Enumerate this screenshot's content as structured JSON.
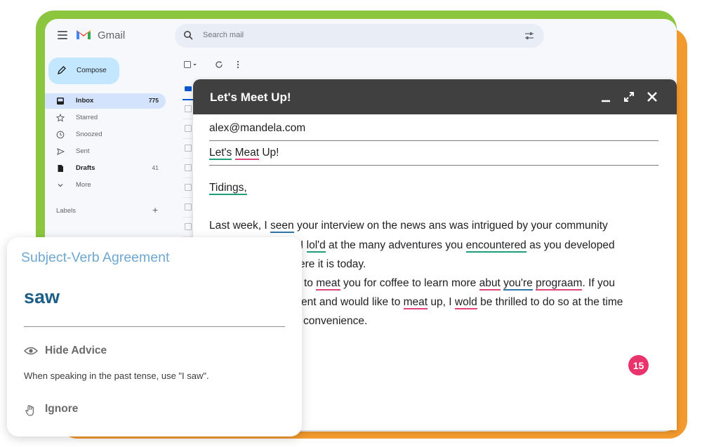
{
  "gmail": {
    "brand": "Gmail",
    "search_placeholder": "Search mail",
    "compose_label": "Compose",
    "nav": [
      {
        "label": "Inbox",
        "count": "775",
        "icon": "inbox-icon"
      },
      {
        "label": "Starred",
        "count": "",
        "icon": "star-icon"
      },
      {
        "label": "Snoozed",
        "count": "",
        "icon": "clock-icon"
      },
      {
        "label": "Sent",
        "count": "",
        "icon": "send-icon"
      },
      {
        "label": "Drafts",
        "count": "41",
        "icon": "draft-icon"
      },
      {
        "label": "More",
        "count": "",
        "icon": "chevron-down-icon"
      }
    ],
    "labels_header": "Labels"
  },
  "compose": {
    "title": "Let's Meet Up!",
    "to": "alex@mandela.com",
    "subject": {
      "w1": "Let's",
      "w2": " ",
      "w3": "Meat",
      "w4": " Up!"
    },
    "greeting": "Tidings,",
    "line1": {
      "a": "Last week, I ",
      "b": "seen",
      "c": " your interview on the news ans was intrigued by your community"
    },
    "line2": {
      "a": "I ",
      "b": "lol'd",
      "c": " at the many adventures you ",
      "d": "encountered",
      "e": " as you developed"
    },
    "line3": {
      "a": "ere it is today."
    },
    "line4": {
      "a": "to ",
      "b": "meat",
      "c": " you for coffee to learn more ",
      "d": "abut",
      "e": " ",
      "f": "you're",
      "g": " ",
      "h": "prograam",
      "i": ". If you"
    },
    "line5": {
      "a": "ent and would like to ",
      "b": "meat",
      "c": " up, I ",
      "d": "wold",
      "e": " be thrilled to do so at the time"
    },
    "line6": {
      "a": "convenience."
    },
    "issue_count": "15"
  },
  "suggestion": {
    "category": "Subject-Verb Agreement",
    "replacement": "saw",
    "hide_advice": "Hide Advice",
    "advice": "When speaking in the past tense, use \"I saw\".",
    "ignore": "Ignore"
  },
  "colors": {
    "green_frame": "#8cc63f",
    "orange_frame": "#f29a2e",
    "issue_green": "#1e9e7b",
    "issue_red": "#e0447a",
    "issue_blue": "#2e76a8",
    "badge": "#e8336c",
    "header_dark": "#404040"
  }
}
